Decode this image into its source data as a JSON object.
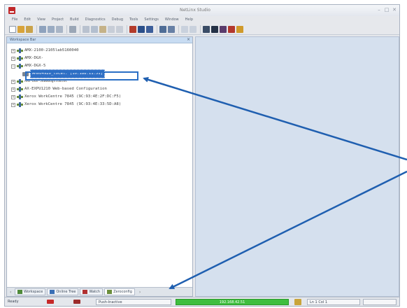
{
  "window": {
    "title": "NetLinx Studio",
    "controls": [
      "–",
      "□",
      "✕"
    ]
  },
  "menu": [
    "File",
    "Edit",
    "View",
    "Project",
    "Build",
    "Diagnostics",
    "Debug",
    "Tools",
    "Settings",
    "Window",
    "Help"
  ],
  "workspace": {
    "title": "Workspace Bar",
    "close_label": "×",
    "tree": [
      {
        "expander": "+",
        "label": "AMX-2100-2105lab5160040"
      },
      {
        "expander": "+",
        "label": "AMX-DGX-"
      },
      {
        "expander": "–",
        "label": "AMX-DGX-5"
      },
      {
        "expander": "",
        "label": "AMX04920_local. [10.188.11.51]",
        "selected": true
      },
      {
        "expander": "+",
        "label": "AMX-DGX-54000ugstudios"
      },
      {
        "expander": "+",
        "label": "AX-EXPU1210 Web-based Configuration"
      },
      {
        "expander": "+",
        "label": "Xerox WorkCentre 7845 (9C:93:4E:2F:DC:F5)"
      },
      {
        "expander": "+",
        "label": "Xerox WorkCentre 7845 (9C:93:4E:33:5D:A8)"
      }
    ],
    "tabs": [
      {
        "label": "Workspace",
        "color": "#4f8a3a"
      },
      {
        "label": "Online Tree",
        "color": "#3a6fb5"
      },
      {
        "label": "Watch",
        "color": "#b03030"
      },
      {
        "label": "Zeroconfig",
        "color": "#6b8e3c",
        "active": true
      }
    ]
  },
  "status": {
    "ready": "Ready",
    "mode": "Push-Inactive",
    "ip": "192.168.42.51",
    "position": "Ln 1 Col 1"
  },
  "colors": {
    "accent": "#2f6fc5",
    "status_ip_bg": "#3fbe3f"
  }
}
